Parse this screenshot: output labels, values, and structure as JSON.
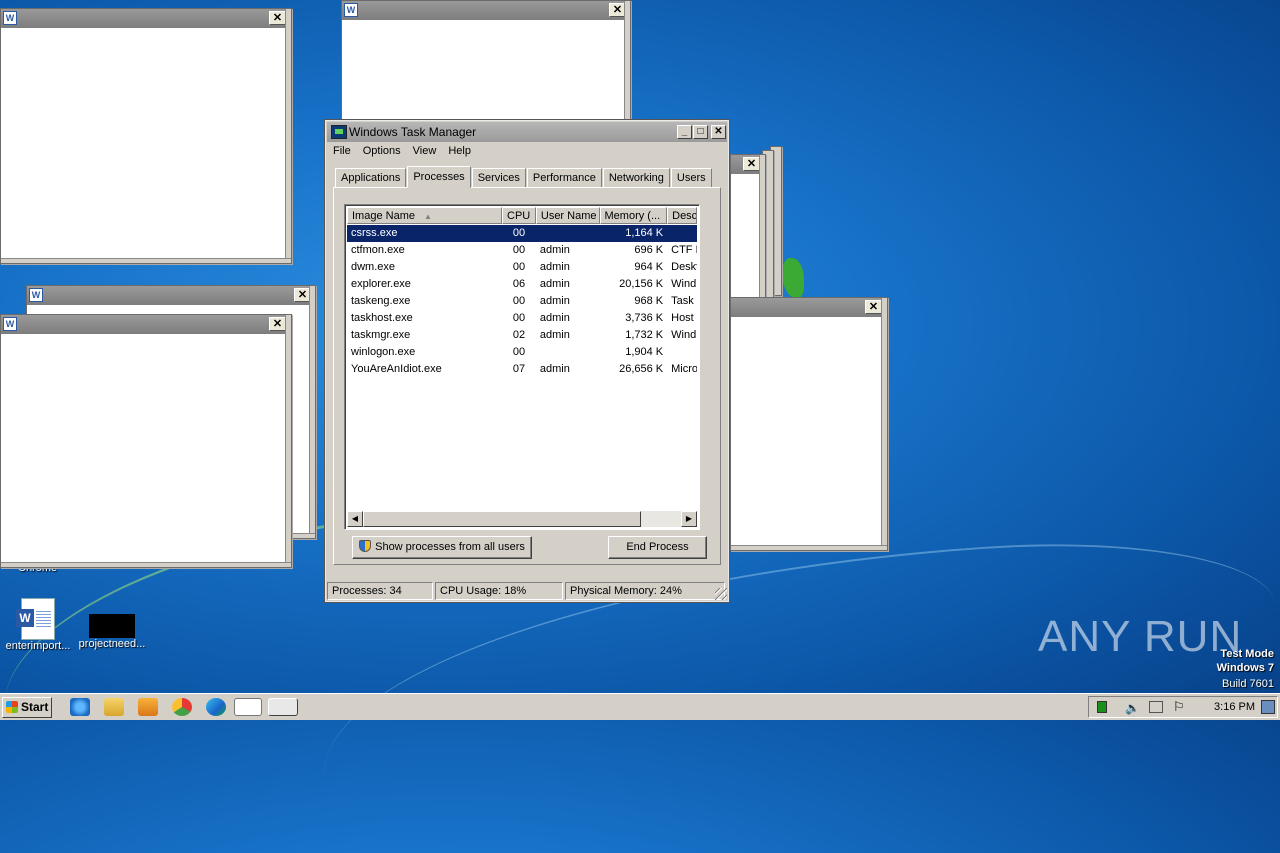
{
  "task_manager": {
    "title": "Windows Task Manager",
    "menu": [
      "File",
      "Options",
      "View",
      "Help"
    ],
    "tabs": [
      "Applications",
      "Processes",
      "Services",
      "Performance",
      "Networking",
      "Users"
    ],
    "active_tab": "Processes",
    "columns": [
      "Image Name",
      "CPU",
      "User Name",
      "Memory (...",
      "Desc"
    ],
    "sort_indicator": "▲",
    "processes": [
      {
        "name": "csrss.exe",
        "cpu": "00",
        "user": "",
        "memory": "1,164 K",
        "desc": ""
      },
      {
        "name": "ctfmon.exe",
        "cpu": "00",
        "user": "admin",
        "memory": "696 K",
        "desc": "CTF L"
      },
      {
        "name": "dwm.exe",
        "cpu": "00",
        "user": "admin",
        "memory": "964 K",
        "desc": "Deskt"
      },
      {
        "name": "explorer.exe",
        "cpu": "06",
        "user": "admin",
        "memory": "20,156 K",
        "desc": "Wind"
      },
      {
        "name": "taskeng.exe",
        "cpu": "00",
        "user": "admin",
        "memory": "968 K",
        "desc": "Task"
      },
      {
        "name": "taskhost.exe",
        "cpu": "00",
        "user": "admin",
        "memory": "3,736 K",
        "desc": "Host"
      },
      {
        "name": "taskmgr.exe",
        "cpu": "02",
        "user": "admin",
        "memory": "1,732 K",
        "desc": "Wind"
      },
      {
        "name": "winlogon.exe",
        "cpu": "00",
        "user": "",
        "memory": "1,904 K",
        "desc": ""
      },
      {
        "name": "YouAreAnIdiot.exe",
        "cpu": "07",
        "user": "admin",
        "memory": "26,656 K",
        "desc": "Micro"
      }
    ],
    "selected_index": 0,
    "show_all_label": "Show processes from all users",
    "end_process_label": "End Process",
    "status": {
      "processes": "Processes: 34",
      "cpu": "CPU Usage: 18%",
      "memory": "Physical Memory: 24%"
    }
  },
  "desktop": {
    "icons": [
      {
        "label": "enterimport...",
        "icon": "word-document-icon"
      },
      {
        "label": "projectneed...",
        "icon": "black-thumbnail-icon"
      }
    ],
    "partial_label_chrome": "Chrome",
    "watermark": {
      "text": "ANY RUN",
      "lines": [
        "Test Mode",
        "Windows 7",
        "Build 7601"
      ]
    }
  },
  "taskbar": {
    "start_label": "Start",
    "clock": "3:16 PM",
    "pinned": [
      "ie-icon",
      "explorer-icon",
      "media-player-icon",
      "chrome-icon",
      "edge-icon",
      "word-icon",
      "task-manager-icon"
    ]
  },
  "colors": {
    "selection": "#0a246a",
    "titlebar_inactive": "#9a9a9a",
    "desktop_blue": "#1873c9"
  }
}
